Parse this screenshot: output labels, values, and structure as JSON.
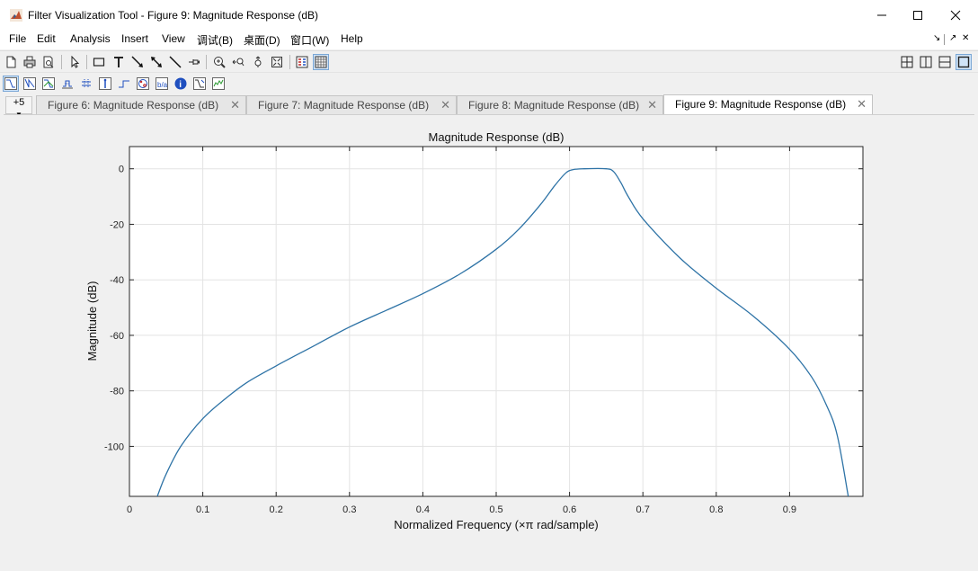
{
  "window": {
    "title": "Filter Visualization Tool - Figure 9: Magnitude Response (dB)",
    "controls": {
      "minimize": "—",
      "maximize": "☐",
      "close": "✕"
    }
  },
  "menubar": {
    "items": [
      "File",
      "Edit",
      "Analysis",
      "Insert",
      "View",
      "调试(B)",
      "桌面(D)",
      "窗口(W)",
      "Help"
    ],
    "dock_controls": [
      "↘",
      "↗",
      "✕"
    ]
  },
  "toolbar": {
    "row1_icons": [
      "new-file-icon",
      "print-icon",
      "print-preview-icon",
      "pointer-icon",
      "rectangle-icon",
      "text-icon",
      "arrow-icon",
      "double-arrow-icon",
      "line-icon",
      "pin-icon",
      "zoom-in-icon",
      "zoom-x-icon",
      "zoom-y-icon",
      "full-view-icon",
      "legend-icon",
      "grid-icon"
    ],
    "layout_icons": [
      "tile-grid-icon",
      "tile-columns-icon",
      "tile-rows-icon",
      "single-view-icon"
    ],
    "row2_icons": [
      "magnitude-response-icon",
      "phase-response-icon",
      "magnitude-phase-icon",
      "group-delay-icon",
      "phase-delay-icon",
      "impulse-response-icon",
      "step-response-icon",
      "pole-zero-icon",
      "coefficients-icon",
      "filter-info-icon",
      "magnitude-estimate-icon",
      "noise-psd-icon"
    ]
  },
  "tabs": {
    "more_label": "+5",
    "items": [
      {
        "label": "Figure 6: Magnitude Response (dB)",
        "active": false
      },
      {
        "label": "Figure 7: Magnitude Response (dB)",
        "active": false
      },
      {
        "label": "Figure 8: Magnitude Response (dB)",
        "active": false
      },
      {
        "label": "Figure 9: Magnitude Response (dB)",
        "active": true
      }
    ],
    "close_glyph": "✕"
  },
  "chart_data": {
    "type": "line",
    "title": "Magnitude Response (dB)",
    "xlabel": "Normalized Frequency (×π rad/sample)",
    "ylabel": "Magnitude (dB)",
    "xlim": [
      0,
      1
    ],
    "ylim": [
      -118,
      8
    ],
    "xticks": [
      0,
      0.1,
      0.2,
      0.3,
      0.4,
      0.5,
      0.6,
      0.7,
      0.8,
      0.9
    ],
    "xtick_labels": [
      "0",
      "0.1",
      "0.2",
      "0.3",
      "0.4",
      "0.5",
      "0.6",
      "0.7",
      "0.8",
      "0.9"
    ],
    "yticks": [
      0,
      -20,
      -40,
      -60,
      -80,
      -100
    ],
    "ytick_labels": [
      "0",
      "-20",
      "-40",
      "-60",
      "-80",
      "-100"
    ],
    "grid": true,
    "line_color": "#2e73a6",
    "series": [
      {
        "x": [
          0.038,
          0.05,
          0.07,
          0.1,
          0.13,
          0.16,
          0.2,
          0.25,
          0.3,
          0.35,
          0.4,
          0.45,
          0.5,
          0.53,
          0.56,
          0.58,
          0.595,
          0.605,
          0.62,
          0.65,
          0.66,
          0.67,
          0.68,
          0.7,
          0.75,
          0.8,
          0.85,
          0.9,
          0.93,
          0.95,
          0.965,
          0.98
        ],
        "y": [
          -118,
          -110,
          -100,
          -90,
          -83,
          -77,
          -71,
          -64,
          -57,
          -51,
          -45,
          -38,
          -29,
          -22,
          -13,
          -6,
          -1.5,
          -0.3,
          0,
          0,
          -1,
          -5,
          -10,
          -18,
          -32,
          -43,
          -53,
          -65,
          -75,
          -85,
          -96,
          -118
        ]
      }
    ]
  }
}
